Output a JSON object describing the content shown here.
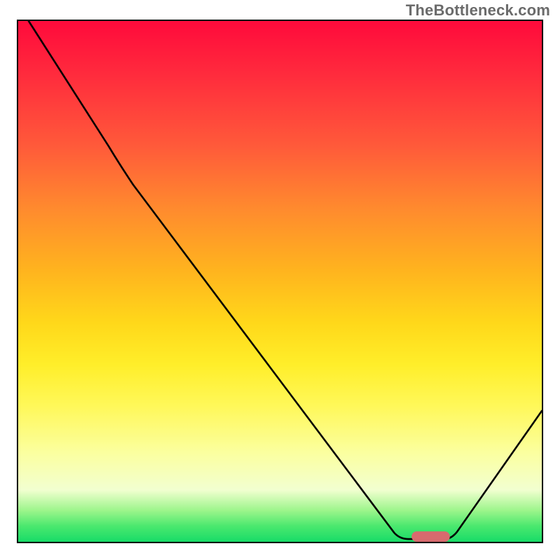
{
  "watermark": "TheBottleneck.com",
  "colors": {
    "gradient_top": "#ff0a3b",
    "gradient_bottom": "#18dc68",
    "curve": "#000000",
    "marker": "#d86a6e",
    "border": "#000000"
  },
  "chart_data": {
    "type": "line",
    "title": "",
    "xlabel": "",
    "ylabel": "",
    "xlim": [
      0,
      100
    ],
    "ylim": [
      0,
      100
    ],
    "series": [
      {
        "name": "bottleneck_curve",
        "x": [
          2,
          17,
          22,
          72,
          74,
          81,
          84,
          100
        ],
        "values": [
          100,
          76,
          69,
          2,
          1,
          1,
          2,
          25
        ]
      }
    ],
    "annotations": [
      {
        "name": "optimal_marker",
        "x_range": [
          75,
          82
        ],
        "y": 1
      }
    ],
    "background": "rainbow_vertical_red_to_green"
  }
}
